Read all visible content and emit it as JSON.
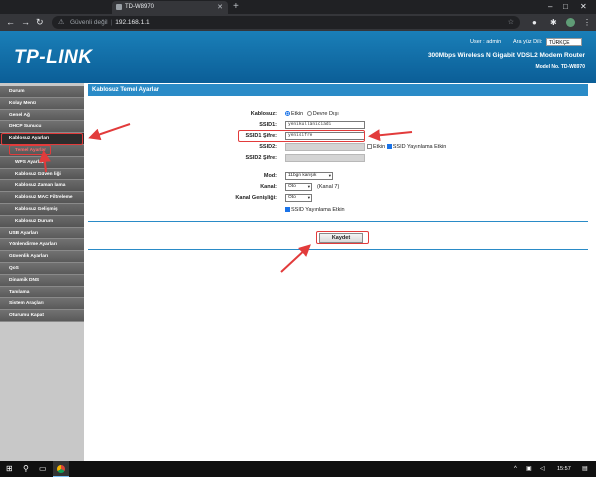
{
  "browser": {
    "tab_title": "TD-W8970",
    "tab_close": "✕",
    "new_tab": "+",
    "address_insecure": "Güvenli değil",
    "address_separator": "|",
    "address_url": "192.168.1.1",
    "icons": [
      "back-icon",
      "forward-icon",
      "reload-icon",
      "warning-icon",
      "star-icon",
      "puzzle-icon",
      "menu-icon"
    ]
  },
  "router": {
    "logo": "TP-LINK",
    "user_label": "User : admin",
    "language_label": "Ara yüz Dili:",
    "language_value": "TÜRKÇE",
    "model_title": "300Mbps Wireless N Gigabit VDSL2 Modem Router",
    "model_no": "Model No. TD-W8970"
  },
  "sidebar": {
    "items": [
      {
        "label": "Durum",
        "sub": false
      },
      {
        "label": "Kolay Menü",
        "sub": false
      },
      {
        "label": "Genel Ağ",
        "sub": false
      },
      {
        "label": "DHCP Sunucu",
        "sub": false
      },
      {
        "label": "Kablosuz Ayarları",
        "sub": false,
        "active": true
      },
      {
        "label": "Temel Ayarlar",
        "sub": true,
        "highlight": true
      },
      {
        "label": "WPS Ayarları",
        "sub": true
      },
      {
        "label": "Kablosuz Güven liği",
        "sub": true
      },
      {
        "label": "Kablosuz Zaman lama",
        "sub": true
      },
      {
        "label": "Kablosuz MAC Filtreleme",
        "sub": true
      },
      {
        "label": "Kablosuz Gelişmiş",
        "sub": true
      },
      {
        "label": "Kablosuz Durum",
        "sub": true
      },
      {
        "label": "USB Ayarları",
        "sub": false
      },
      {
        "label": "Yönlendirme Ayarları",
        "sub": false
      },
      {
        "label": "Güvenlik Ayarları",
        "sub": false
      },
      {
        "label": "QoS",
        "sub": false
      },
      {
        "label": "Dinamik DNS",
        "sub": false
      },
      {
        "label": "Tanılama",
        "sub": false
      },
      {
        "label": "Sistem Araçları",
        "sub": false
      },
      {
        "label": "Oturumu Kapat",
        "sub": false
      }
    ]
  },
  "panel": {
    "title": "Kablosuz Temel Ayarlar",
    "wireless_label": "Kablosuz:",
    "wireless_on": "Etkin",
    "wireless_off": "Devre Dışı",
    "ssid1_label": "SSID1:",
    "ssid1_value": "yenikullaniciadi",
    "ssid1_pass_label": "SSID1 Şifre:",
    "ssid1_pass_value": "yenisifre",
    "ssid2_label": "SSID2:",
    "ssid2_enable": "Etkin",
    "ssid2_broadcast": "SSID Yayınlama Etkin",
    "ssid2_pass_label": "SSID2 Şifre:",
    "mode_label": "Mod:",
    "mode_value": "11bgn karışık",
    "channel_label": "Kanal:",
    "channel_value": "Oto",
    "channel_note": "(Kanal 7)",
    "width_label": "Kanal Genişliği:",
    "width_value": "Oto",
    "broadcast_label": "SSID Yayınlama Etkin",
    "save_label": "Kaydet"
  },
  "taskbar": {
    "clock": "15:57"
  },
  "colors": {
    "header_blue": "#1a7fb8",
    "panel_blue": "#2a8bc7",
    "annotation_red": "#e23b3b"
  }
}
